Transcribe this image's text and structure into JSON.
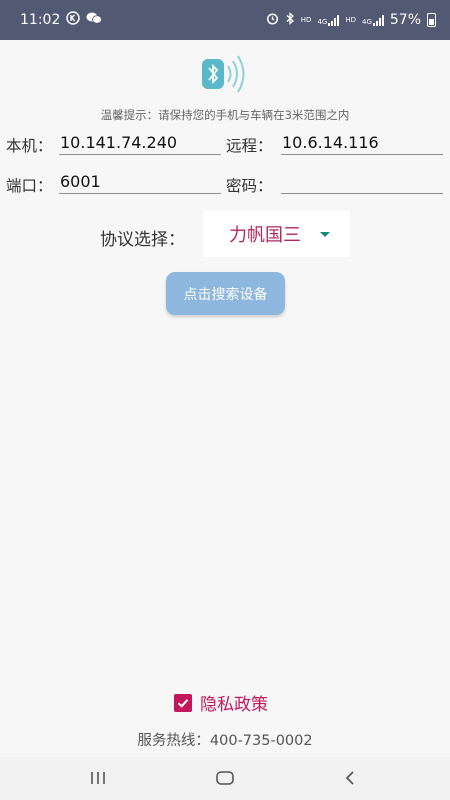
{
  "status_bar": {
    "time": "11:02",
    "left_icons": [
      "k-circle-icon",
      "wechat-icon"
    ],
    "right_icons": [
      "alarm-icon",
      "bluetooth-icon",
      "hd-icon",
      "4g-signal-icon",
      "hd-icon",
      "4g-signal-icon"
    ],
    "hd_label": "HD",
    "g4_label": "4G",
    "battery": "57%"
  },
  "header": {
    "logo_icon": "bluetooth-signal-icon",
    "hint": "温馨提示：请保持您的手机与车辆在3米范围之内"
  },
  "form": {
    "local_label": "本机：",
    "local_value": "10.141.74.240",
    "remote_label": "远程：",
    "remote_value": "10.6.14.116",
    "port_label": "端口：",
    "port_value": "6001",
    "password_label": "密码：",
    "password_value": ""
  },
  "protocol": {
    "label": "协议选择：",
    "selected": "力帆国三"
  },
  "search_button": "点击搜索设备",
  "privacy": {
    "checked": true,
    "label": "隐私政策"
  },
  "hotline": "服务热线：400-735-0002",
  "colors": {
    "status_bar": "#525a73",
    "accent": "#c2185b",
    "button": "#8eb7e0",
    "logo": "#5ab8c8"
  },
  "nav_bar": [
    "recent-apps-icon",
    "home-icon",
    "back-icon"
  ]
}
